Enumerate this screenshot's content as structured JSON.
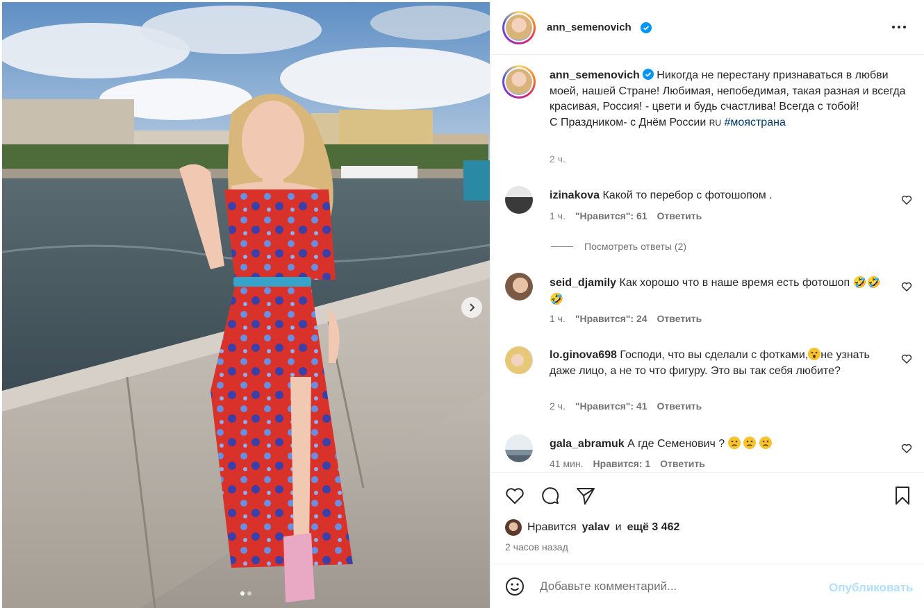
{
  "post": {
    "username": "ann_semenovich",
    "verified": true,
    "more_icon": "more-horizontal-icon"
  },
  "caption": {
    "username": "ann_semenovich",
    "text": "Никогда не перестану признаваться в любви моей, нашей Стране! Любимая, непобедимая, такая разная и всегда красивая, Россия! - цвети и будь счастлива! Всегда с тобой!",
    "line2": "С Праздником- с Днём России",
    "flag_text": "RU",
    "hashtag": "#моястрана",
    "time": "2 ч."
  },
  "comments": [
    {
      "username": "izinakova",
      "text": "Какой то перебор с фотошопом .",
      "time": "1 ч.",
      "likes": "\"Нравится\": 61",
      "reply": "Ответить"
    },
    {
      "username": "seid_djamily",
      "text": "Как хорошо что в наше время есть фотошоп",
      "emojis": "🤣🤣🤣",
      "time": "1 ч.",
      "likes": "\"Нравится\": 24",
      "reply": "Ответить"
    },
    {
      "username": "lo.ginova698",
      "text_before": "Господи, что вы сделали с фотками,",
      "text_after": "не узнать даже лицо, а не то что фигуру. Это вы так себя любите?",
      "time": "2 ч.",
      "likes": "\"Нравится\": 41",
      "reply": "Ответить"
    },
    {
      "username": "gala_abramuk",
      "text": "А где Семенович ?",
      "time": "41 мин.",
      "likes": "Нравится: 1",
      "reply": "Ответить"
    }
  ],
  "view_replies": "Посмотреть ответы (2)",
  "likes_summary": {
    "prefix": "Нравится",
    "user": "yalav",
    "conj": "и",
    "rest": "ещё 3 462"
  },
  "posted_ago": "2 часов назад",
  "add_comment": {
    "placeholder": "Добавьте комментарий...",
    "publish": "Опубликовать"
  },
  "carousel": {
    "count": 2,
    "active_index": 0
  },
  "colors": {
    "link": "#00376b",
    "muted": "#737373",
    "publish_disabled": "#b2dffc",
    "verified": "#0095f6"
  }
}
